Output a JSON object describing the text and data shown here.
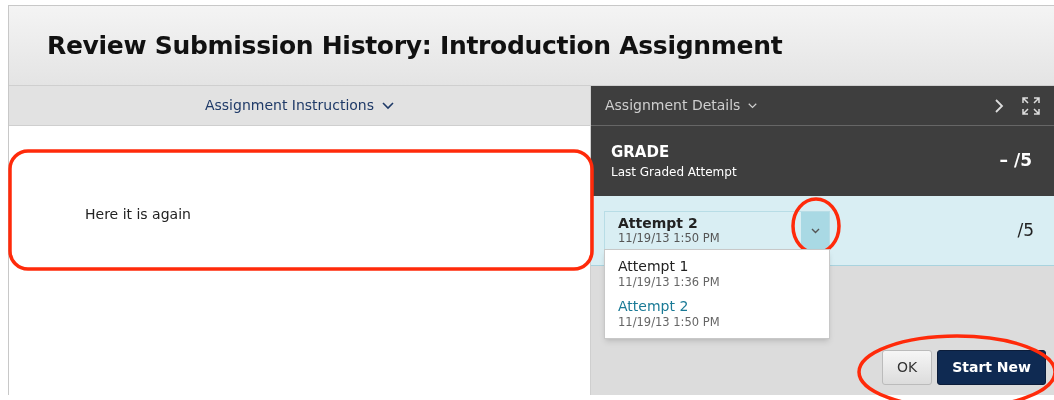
{
  "window": {
    "title": "Review Submission History: Introduction Assignment"
  },
  "instructions_panel": {
    "header": "Assignment Instructions",
    "expanded": true,
    "body": "Here it is again"
  },
  "details_panel": {
    "header": "Assignment Details",
    "grade": {
      "label": "GRADE",
      "sublabel": "Last Graded Attempt",
      "score": "– /5"
    },
    "attempt_picker": {
      "title": "Attempt 2",
      "date": "11/19/13 1:50 PM",
      "score": "/5",
      "open": true
    },
    "attempt_menu": [
      {
        "title": "Attempt 1",
        "date": "11/19/13 1:36 PM",
        "selected": false
      },
      {
        "title": "Attempt 2",
        "date": "11/19/13 1:50 PM",
        "selected": true
      }
    ],
    "buttons": [
      {
        "label": "OK",
        "kind": "secondary"
      },
      {
        "label": "Start New",
        "kind": "primary"
      }
    ]
  }
}
